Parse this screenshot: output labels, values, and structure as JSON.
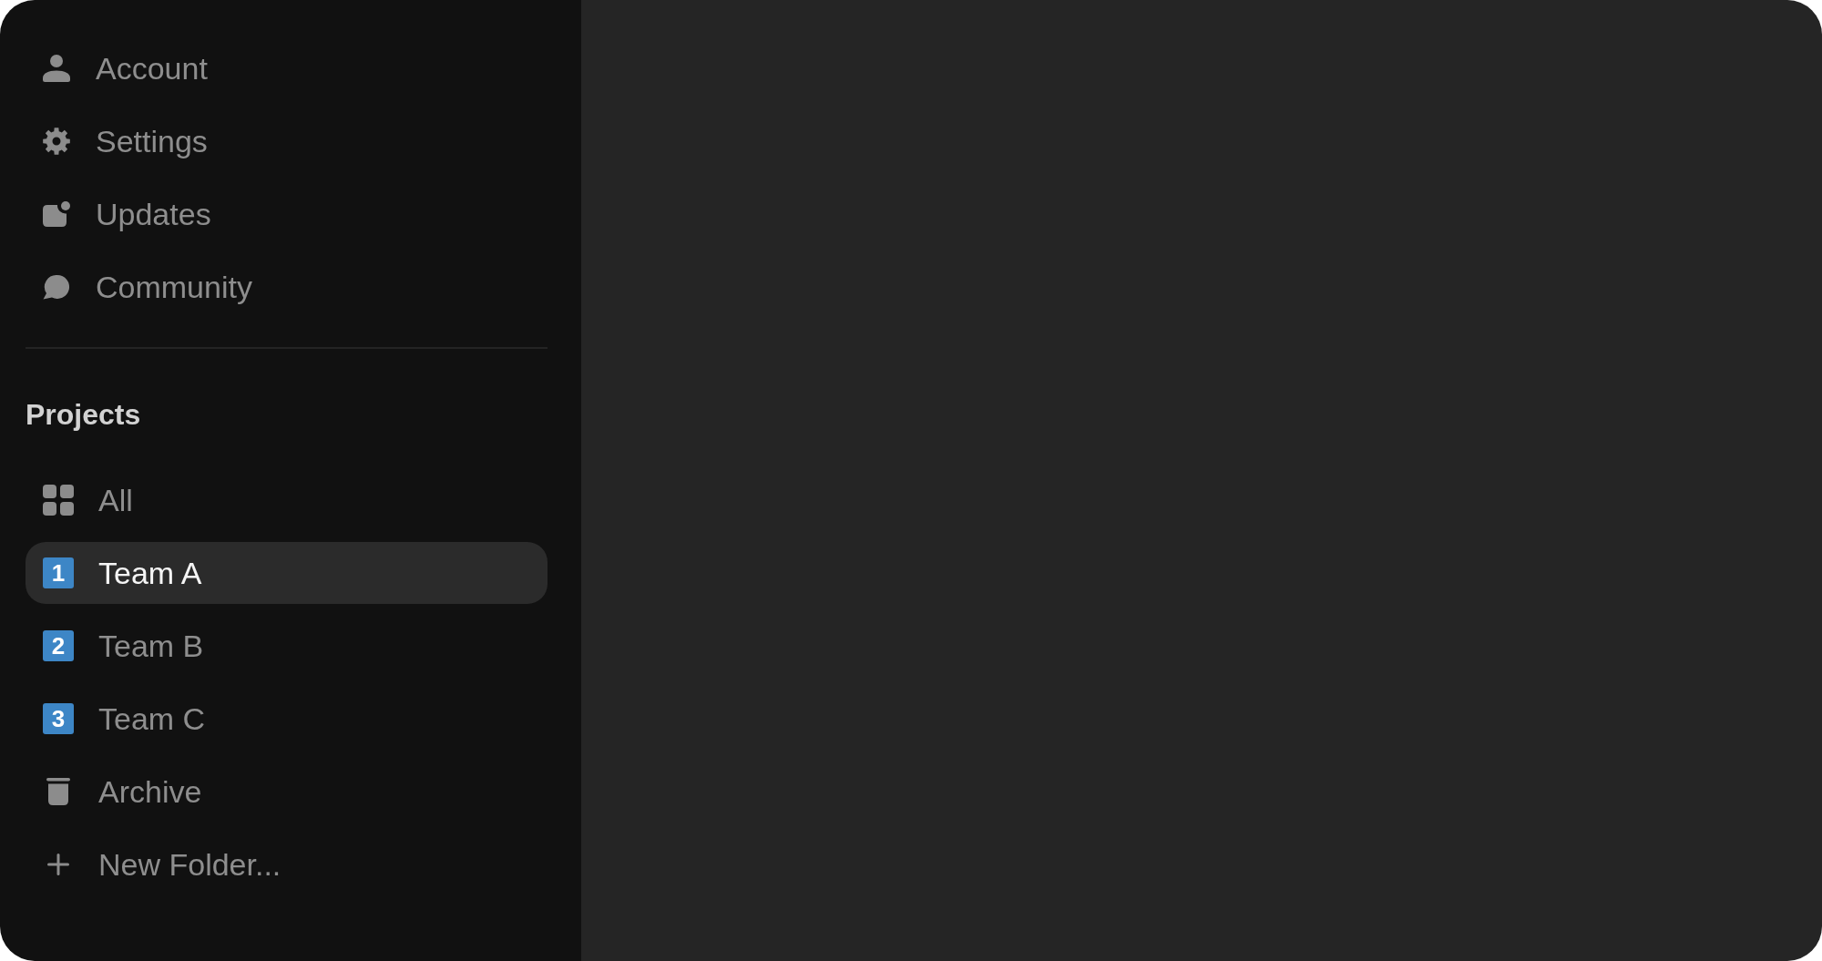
{
  "sidebar": {
    "menu": [
      {
        "label": "Account",
        "selected": false
      },
      {
        "label": "Settings",
        "selected": false
      },
      {
        "label": "Updates",
        "selected": false
      },
      {
        "label": "Community",
        "selected": false
      }
    ],
    "projects": {
      "heading": "Projects",
      "items": [
        {
          "kind": "all",
          "label": "All",
          "selected": false
        },
        {
          "kind": "team",
          "badge": "1",
          "label": "Team A",
          "selected": true
        },
        {
          "kind": "team",
          "badge": "2",
          "label": "Team B",
          "selected": false
        },
        {
          "kind": "team",
          "badge": "3",
          "label": "Team C",
          "selected": false
        },
        {
          "kind": "archive",
          "label": "Archive",
          "selected": false
        },
        {
          "kind": "create",
          "label": "New Folder...",
          "selected": false
        }
      ]
    }
  }
}
